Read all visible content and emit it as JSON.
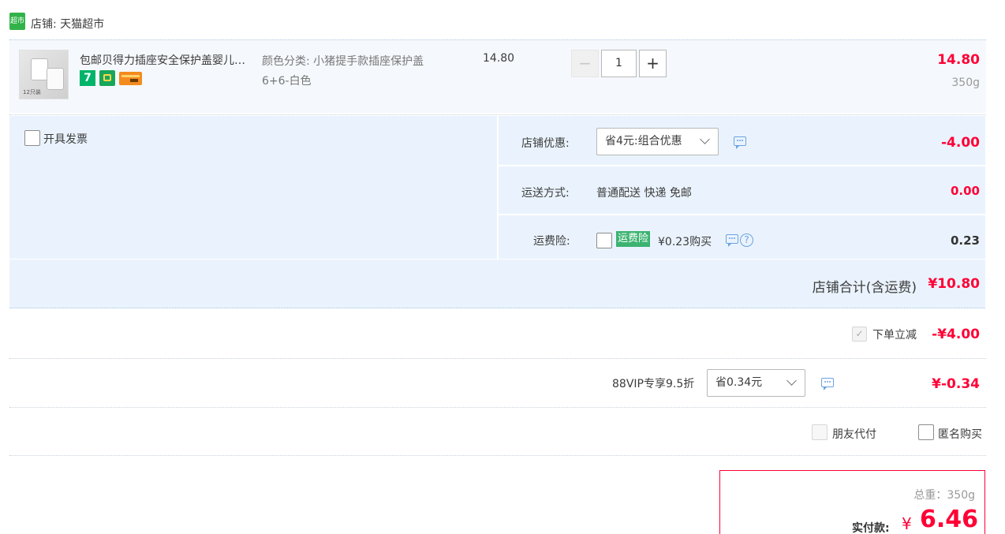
{
  "shop": {
    "badge": "超市",
    "label": "店铺: 天猫超市"
  },
  "item": {
    "thumb_text": "12只装",
    "title": "包邮贝得力插座安全保护盖婴儿…",
    "sku_label": "颜色分类: 小猪提手款插座保护盖",
    "sku_value": "6+6-白色",
    "unit_price": "14.80",
    "qty": "1",
    "qty_minus": "−",
    "qty_plus": "+",
    "subtotal": "14.80",
    "weight": "350g",
    "badges": [
      {
        "name": "7",
        "color": "#00b46a"
      },
      {
        "name": "plug",
        "color": "#18a65a"
      },
      {
        "name": "card",
        "color": "#f38b1f"
      }
    ]
  },
  "invoice": {
    "label": "开具发票"
  },
  "shop_discount": {
    "label": "店铺优惠:",
    "select": "省4元:组合优惠",
    "amount": "-4.00"
  },
  "shipping": {
    "label": "运送方式:",
    "value": "普通配送 快递 免邮",
    "amount": "0.00"
  },
  "insurance": {
    "label": "运费险:",
    "tag": "运费险",
    "price": "¥0.23购买",
    "amount": "0.23"
  },
  "shop_total": {
    "label": "店铺合计(含运费)",
    "amount": "¥10.80"
  },
  "order_reduce": {
    "label": "下单立减",
    "amount": "-¥4.00"
  },
  "vip": {
    "label": "88VIP专享9.5折",
    "select": "省0.34元",
    "amount": "¥-0.34"
  },
  "options": {
    "friend_pay": "朋友代付",
    "anonymous": "匿名购买"
  },
  "summary": {
    "weight": "总重：350g",
    "pay_label": "实付款:",
    "currency": "¥",
    "pay_amount": "6.46"
  },
  "colors": {
    "price_red": "#ff0036",
    "band_blue": "#eaf3fd",
    "insurance_green": "#3cb371"
  }
}
